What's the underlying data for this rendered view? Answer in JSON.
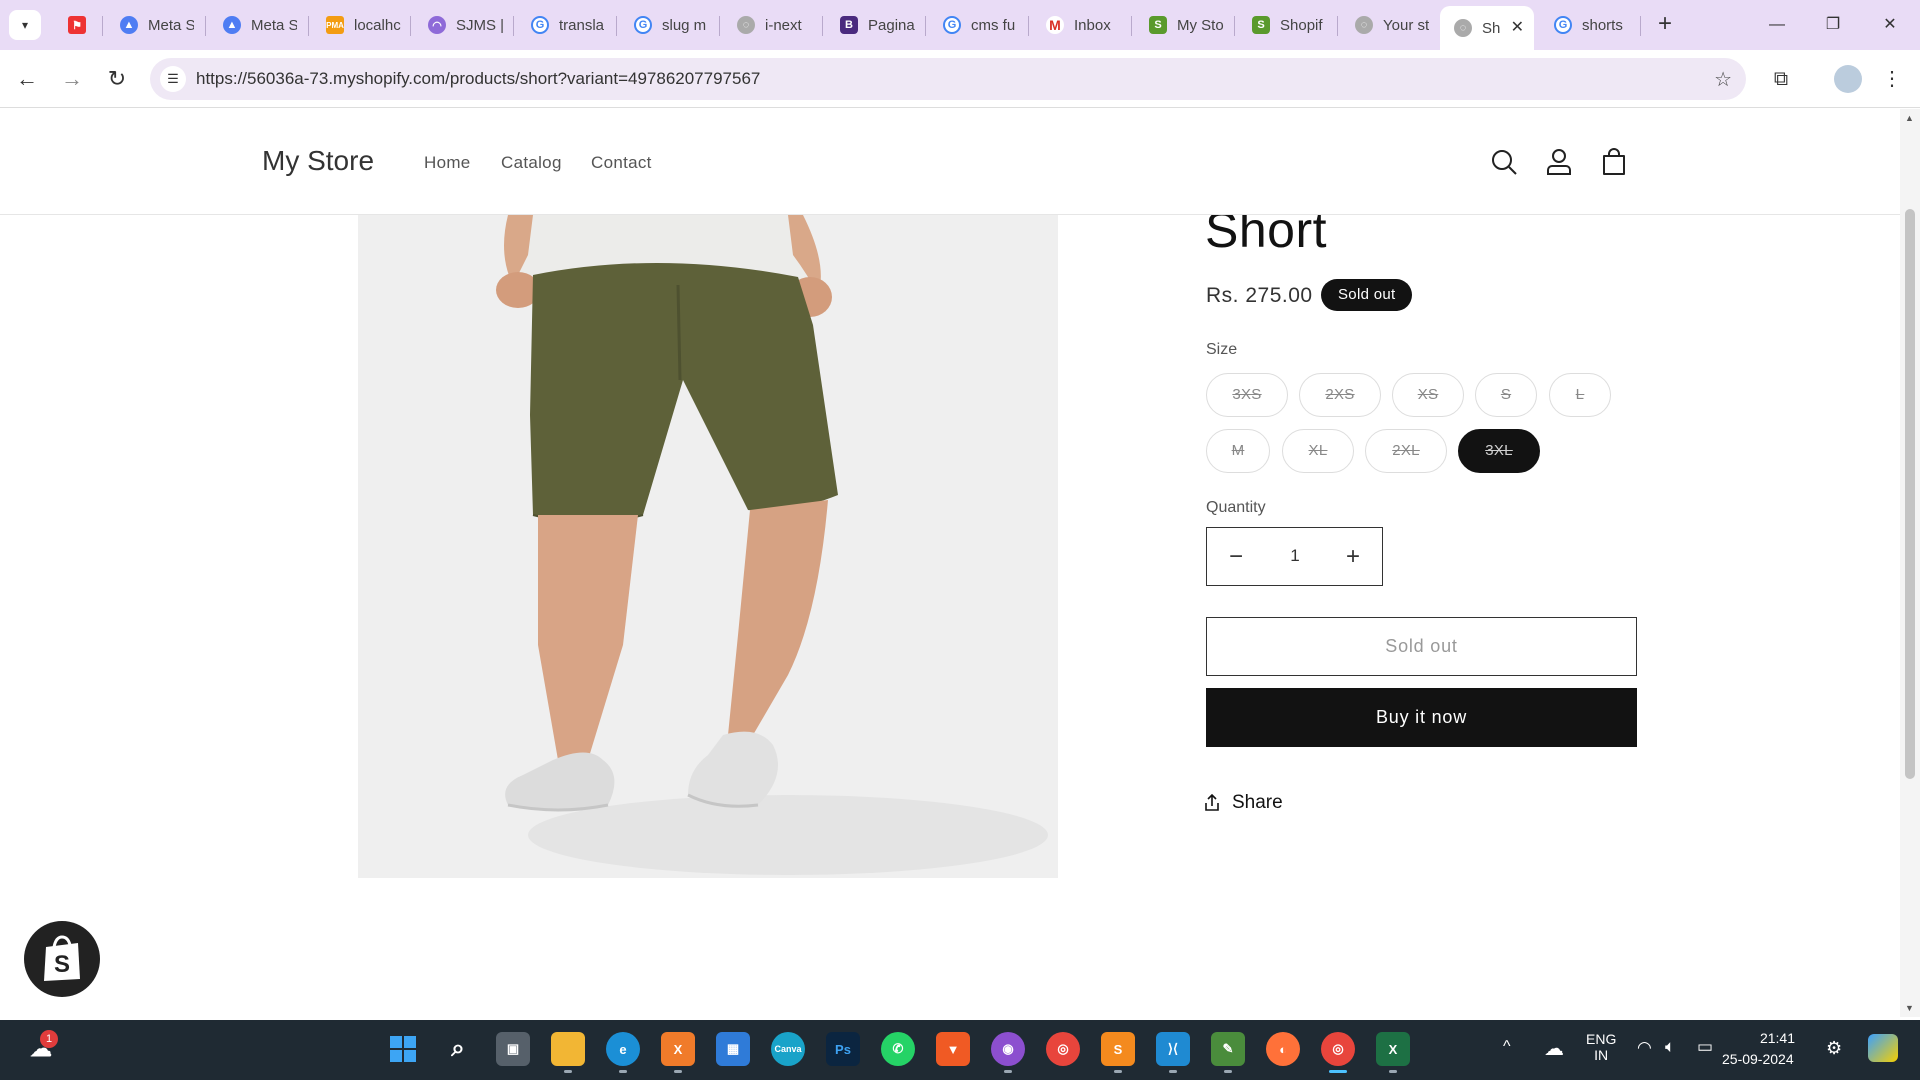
{
  "browser": {
    "tabs": [
      {
        "label": "",
        "icon": "bookmark-icon",
        "color": "#e33"
      },
      {
        "label": "Meta S",
        "icon": "meta-icon",
        "color": "#4f7df3"
      },
      {
        "label": "Meta S",
        "icon": "meta-icon",
        "color": "#4f7df3"
      },
      {
        "label": "localhc",
        "icon": "pma-icon",
        "color": "#f39c12"
      },
      {
        "label": "SJMS |",
        "icon": "rainbow-icon",
        "color": "#8e6ad8"
      },
      {
        "label": "transla",
        "icon": "google-icon",
        "color": "#4285f4"
      },
      {
        "label": "slug m",
        "icon": "google-icon",
        "color": "#4285f4"
      },
      {
        "label": "i-next",
        "icon": "globe-icon",
        "color": "#888"
      },
      {
        "label": "Pagina",
        "icon": "bootstrap-icon",
        "color": "#4a2a7e"
      },
      {
        "label": "cms fu",
        "icon": "google-icon",
        "color": "#4285f4"
      },
      {
        "label": "Inbox",
        "icon": "gmail-icon",
        "color": "#d93025"
      },
      {
        "label": "My Sto",
        "icon": "shopify-icon",
        "color": "#5a9a2c"
      },
      {
        "label": "Shopif",
        "icon": "shopify-icon",
        "color": "#5a9a2c"
      },
      {
        "label": "Your st",
        "icon": "globe-icon",
        "color": "#888"
      },
      {
        "label": "Sh",
        "icon": "globe-icon",
        "color": "#888",
        "active": true
      },
      {
        "label": "shorts",
        "icon": "google-icon",
        "color": "#4285f4"
      }
    ],
    "url": "https://56036a-73.myshopify.com/products/short?variant=49786207797567"
  },
  "header": {
    "store_name": "My Store",
    "nav": [
      "Home",
      "Catalog",
      "Contact"
    ]
  },
  "product": {
    "title": "Short",
    "price": "Rs. 275.00",
    "badge": "Sold out",
    "size_label": "Size",
    "sizes": [
      "3XS",
      "2XS",
      "XS",
      "S",
      "L",
      "M",
      "XL",
      "2XL",
      "3XL"
    ],
    "selected_size": "3XL",
    "quantity_label": "Quantity",
    "quantity": "1",
    "soldout_button": "Sold out",
    "buy_button": "Buy it now",
    "share_label": "Share"
  },
  "taskbar": {
    "weather_badge": "1",
    "lang_top": "ENG",
    "lang_bottom": "IN",
    "time": "21:41",
    "date": "25-09-2024"
  },
  "colors": {
    "tab_bar": "#e9dcf6",
    "omnibox": "#efe8f5",
    "accent_dark": "#121212",
    "taskbar": "#1f2a33",
    "shorts": "#5e6139"
  }
}
